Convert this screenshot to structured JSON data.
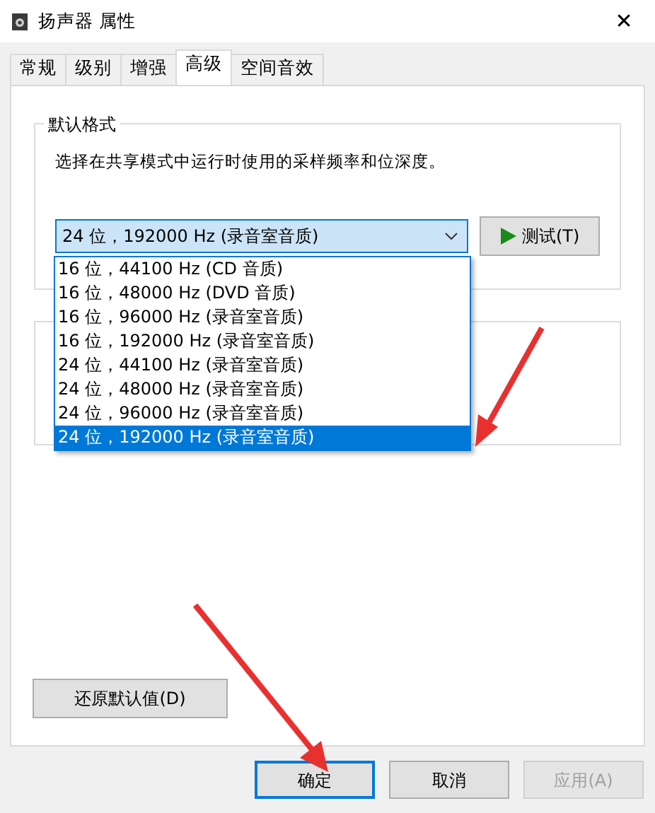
{
  "window": {
    "title": "扬声器 属性",
    "close": "✕"
  },
  "tabs": [
    {
      "label": "常规",
      "selected": false
    },
    {
      "label": "级别",
      "selected": false
    },
    {
      "label": "增强",
      "selected": false
    },
    {
      "label": "高级",
      "selected": true
    },
    {
      "label": "空间音效",
      "selected": false
    }
  ],
  "default_format": {
    "title": "默认格式",
    "description": "选择在共享模式中运行时使用的采样频率和位深度。",
    "dropdown": {
      "value": "24 位，192000 Hz (录音室音质)",
      "expanded": true,
      "options": [
        {
          "label": "16 位，44100 Hz (CD 音质)",
          "selected": false
        },
        {
          "label": "16 位，48000 Hz (DVD 音质)",
          "selected": false
        },
        {
          "label": "16 位，96000 Hz (录音室音质)",
          "selected": false
        },
        {
          "label": "16 位，192000 Hz (录音室音质)",
          "selected": false
        },
        {
          "label": "24 位，44100 Hz (录音室音质)",
          "selected": false
        },
        {
          "label": "24 位，48000 Hz (录音室音质)",
          "selected": false
        },
        {
          "label": "24 位，96000 Hz (录音室音质)",
          "selected": false
        },
        {
          "label": "24 位，192000 Hz (录音室音质)",
          "selected": true
        }
      ]
    },
    "test_button": "测试(T)"
  },
  "restore_button": "还原默认值(D)",
  "buttons": [
    {
      "label": "确定",
      "disabled": false,
      "focused": true
    },
    {
      "label": "取消",
      "disabled": false,
      "focused": false
    },
    {
      "label": "应用(A)",
      "disabled": true,
      "focused": false
    }
  ]
}
